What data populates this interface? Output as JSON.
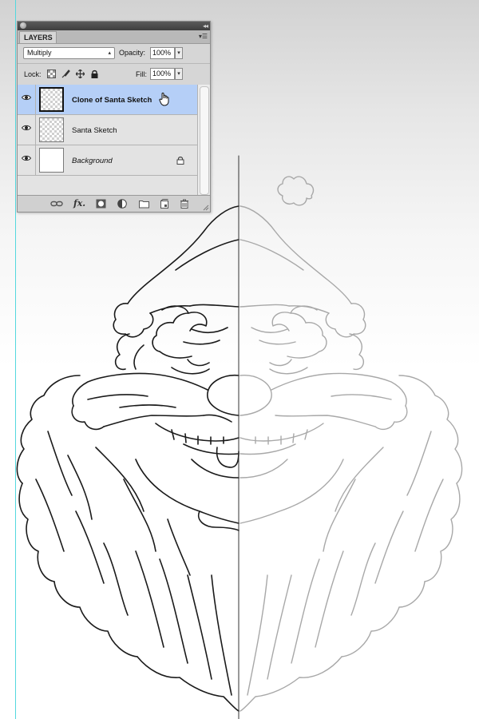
{
  "panel": {
    "tab_label": "LAYERS",
    "blend_mode": "Multiply",
    "opacity_label": "Opacity:",
    "opacity_value": "100%",
    "lock_label": "Lock:",
    "fill_label": "Fill:",
    "fill_value": "100%",
    "layers": [
      {
        "name": "Clone of Santa Sketch",
        "visible": true,
        "selected": true
      },
      {
        "name": "Santa Sketch",
        "visible": true,
        "selected": false
      },
      {
        "name": "Background",
        "visible": true,
        "selected": false,
        "locked": true
      }
    ],
    "bottom_icons": [
      "link-layers-icon",
      "fx-icon",
      "layer-mask-icon",
      "adjustment-layer-icon",
      "new-group-icon",
      "new-layer-icon",
      "trash-icon"
    ]
  },
  "colors": {
    "selection": "#b5cff7",
    "guide": "#54d8de",
    "sketch_dark": "#1a1a1a",
    "sketch_light": "#a8a8a8"
  }
}
